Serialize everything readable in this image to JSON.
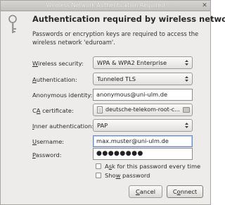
{
  "window": {
    "title": "Wireless Network Authentication Required",
    "close_glyph": "✕"
  },
  "header": {
    "icon": "lock-key-icon",
    "heading": "Authentication required by wireless network",
    "description": "Passwords or encryption keys are required to access the wireless network 'eduroam'."
  },
  "fields": {
    "wireless_security": {
      "label_pre": "",
      "label_ul": "W",
      "label_post": "ireless security:",
      "value": "WPA & WPA2 Enterprise"
    },
    "authentication": {
      "label_pre": "",
      "label_ul": "A",
      "label_post": "uthentication:",
      "value": "Tunneled TLS"
    },
    "anonymous_identity": {
      "label": "Anonymous identity:",
      "value": "anonymous@uni-ulm.de"
    },
    "ca_certificate": {
      "label_pre": "C",
      "label_ul": "A",
      "label_post": " certificate:",
      "value": "deutsche-telekom-root-c..."
    },
    "inner_auth": {
      "label_pre": "",
      "label_ul": "I",
      "label_post": "nner authentication:",
      "value": "PAP"
    },
    "username": {
      "label_pre": "",
      "label_ul": "U",
      "label_post": "sername:",
      "value": "max.muster@uni-ulm.de"
    },
    "password": {
      "label_pre": "",
      "label_ul": "P",
      "label_post": "assword:",
      "value": "●●●●●●●●"
    }
  },
  "checkboxes": {
    "ask_every_time": {
      "label_pre": "A",
      "label_ul": "s",
      "label_post": "k for this password every time",
      "checked": false
    },
    "show_password": {
      "label_pre": "Sho",
      "label_ul": "w",
      "label_post": " password",
      "checked": false
    }
  },
  "buttons": {
    "cancel": {
      "label_pre": "",
      "label_ul": "C",
      "label_post": "ancel"
    },
    "connect": {
      "label_pre": "C",
      "label_ul": "o",
      "label_post": "nnect"
    }
  }
}
